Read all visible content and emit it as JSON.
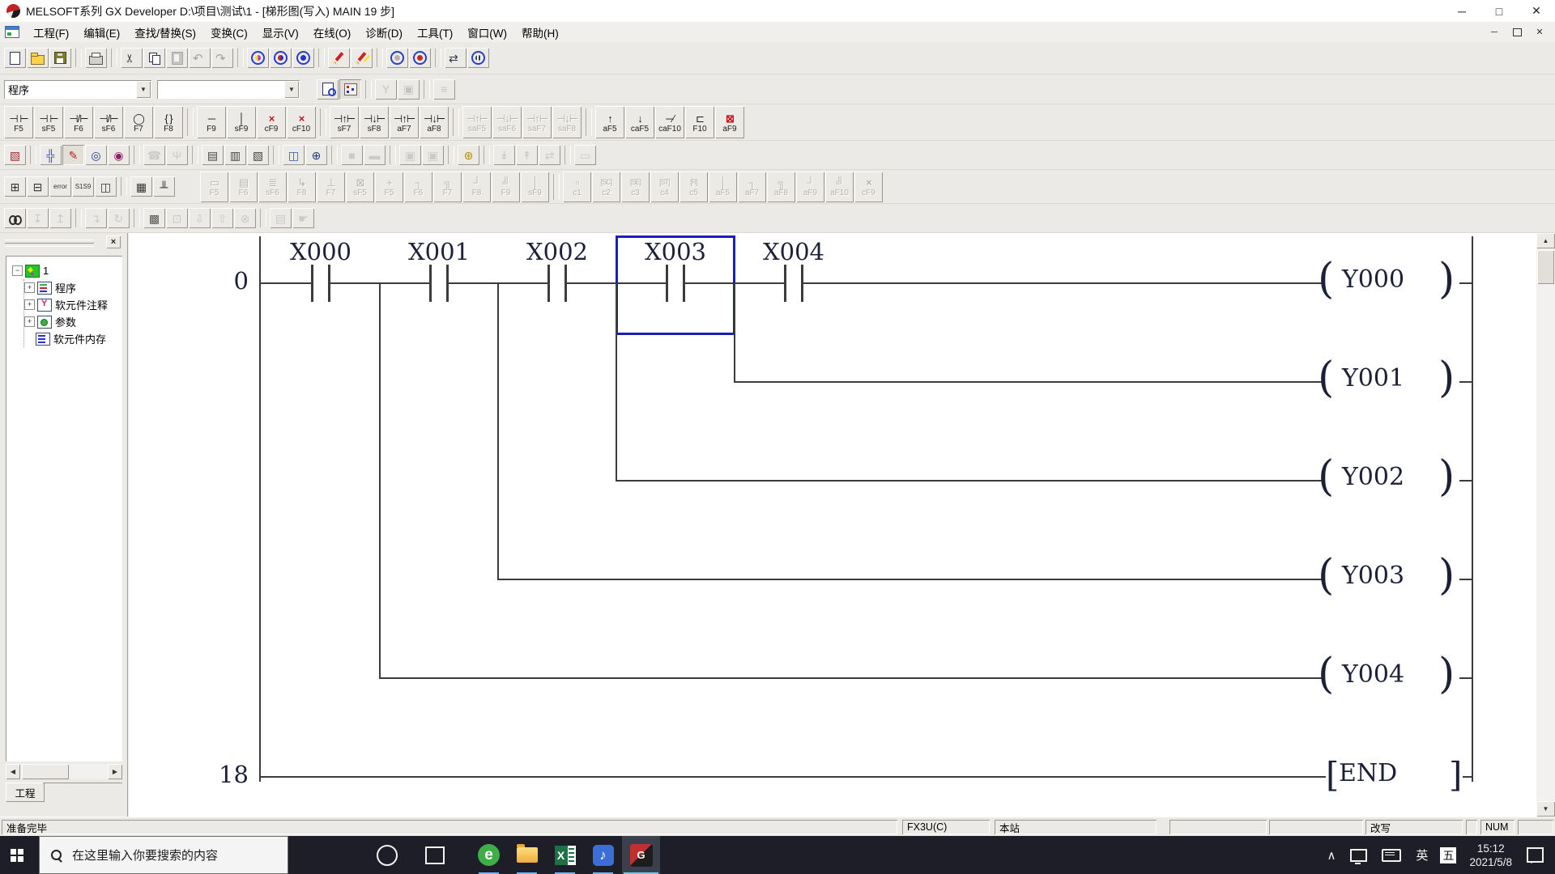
{
  "window": {
    "title": "MELSOFT系列 GX Developer D:\\项目\\测试\\1 - [梯形图(写入)    MAIN   19 步]",
    "controls": [
      {
        "name": "minimize-button",
        "glyph": "─"
      },
      {
        "name": "maximize-button",
        "glyph": "□"
      },
      {
        "name": "close-button",
        "glyph": "✕"
      }
    ],
    "mdi_controls": [
      {
        "name": "child-minimize-button",
        "glyph": "─"
      },
      {
        "name": "child-restore-button",
        "glyph": "❐"
      },
      {
        "name": "child-close-button",
        "glyph": "✕"
      }
    ]
  },
  "menu_bar": {
    "items": [
      "工程(F)",
      "编辑(E)",
      "查找/替换(S)",
      "变换(C)",
      "显示(V)",
      "在线(O)",
      "诊断(D)",
      "工具(T)",
      "窗口(W)",
      "帮助(H)"
    ]
  },
  "toolbars": {
    "rowA": [
      {
        "name": "new-project-button",
        "icon": "page"
      },
      {
        "name": "open-project-button",
        "icon": "folder"
      },
      {
        "name": "save-project-button",
        "icon": "floppy"
      },
      {
        "sep": true
      },
      {
        "name": "print-button",
        "icon": "printer"
      },
      {
        "sep": true
      },
      {
        "name": "cut-button",
        "icon": "scissors"
      },
      {
        "name": "copy-button",
        "icon": "copy"
      },
      {
        "name": "paste-button",
        "icon": "clipboard",
        "disabled": true
      },
      {
        "name": "undo-button",
        "icon": "undo",
        "disabled": true
      },
      {
        "name": "redo-button",
        "icon": "redo",
        "disabled": true
      },
      {
        "sep": true
      },
      {
        "name": "find-device-button",
        "icon": "ring-device"
      },
      {
        "name": "find-instruction-button",
        "icon": "ring-instruction"
      },
      {
        "name": "find-string-button",
        "icon": "ring-string"
      },
      {
        "sep": true
      },
      {
        "name": "ladder-write-button",
        "icon": "pencil"
      },
      {
        "name": "ladder-monitor-write-button",
        "icon": "pencil-star"
      },
      {
        "sep": true
      },
      {
        "name": "read-mode-button",
        "icon": "ring-read"
      },
      {
        "name": "write-mode-button",
        "icon": "ring-write"
      },
      {
        "sep": true
      },
      {
        "name": "transfer-setup-button",
        "icon": "transfer"
      },
      {
        "name": "monitor-mode-button",
        "icon": "ring-monitor"
      }
    ],
    "rowB": {
      "program_combo_value": "程序",
      "second_combo_value": "",
      "buttons": [
        {
          "name": "find-in-window-button",
          "icon": "page-find"
        },
        {
          "name": "project-tree-toggle-button",
          "icon": "tree",
          "pressed": true
        },
        {
          "sep": true
        },
        {
          "name": "parameter-edit-button",
          "glyph": "Y",
          "disabled": true
        },
        {
          "name": "screen-setting-button",
          "glyph": "▣",
          "disabled": true
        },
        {
          "sep": true
        },
        {
          "name": "program-list-button",
          "glyph": "≡",
          "disabled": true
        }
      ]
    },
    "rowC": [
      {
        "name": "open-contact-button",
        "sym": "⊣ ⊢",
        "label": "F5"
      },
      {
        "name": "open-branch-button",
        "sym": "⊣ ⊢",
        "label": "sF5"
      },
      {
        "name": "close-contact-button",
        "sym": "⊣/⊢",
        "label": "F6"
      },
      {
        "name": "close-branch-button",
        "sym": "⊣/⊢",
        "label": "sF6"
      },
      {
        "name": "coil-button",
        "sym": "◯",
        "label": "F7"
      },
      {
        "name": "application-instruction-button",
        "sym": "{ }",
        "label": "F8"
      },
      {
        "sep": true
      },
      {
        "name": "horizontal-line-button",
        "sym": "─",
        "label": "F9"
      },
      {
        "name": "vertical-line-button",
        "sym": "│",
        "label": "sF9"
      },
      {
        "name": "delete-horizontal-line-button",
        "sym": "×",
        "red": true,
        "label": "cF9"
      },
      {
        "name": "delete-vertical-line-button",
        "sym": "×",
        "red": true,
        "label": "cF10"
      },
      {
        "sep": true
      },
      {
        "name": "rising-pulse-button",
        "sym": "⊣↑⊢",
        "label": "sF7"
      },
      {
        "name": "falling-pulse-button",
        "sym": "⊣↓⊢",
        "label": "sF8"
      },
      {
        "name": "rising-pulse-branch-button",
        "sym": "⊣↑⊢",
        "label": "aF7"
      },
      {
        "name": "falling-pulse-branch-button",
        "sym": "⊣↓⊢",
        "label": "aF8"
      },
      {
        "sep": true
      },
      {
        "name": "rising-pulse-close-button",
        "sym": "⊣↑⊢",
        "label": "saF5",
        "disabled": true
      },
      {
        "name": "falling-pulse-close-button",
        "sym": "⊣↓⊢",
        "label": "saF6",
        "disabled": true
      },
      {
        "name": "rising-pulse-close-branch-button",
        "sym": "⊣↑⊢",
        "label": "saF7",
        "disabled": true
      },
      {
        "name": "falling-pulse-close-branch-button",
        "sym": "⊣↓⊢",
        "label": "saF8",
        "disabled": true
      },
      {
        "sep": true
      },
      {
        "name": "pulse-up-button",
        "sym": "↑",
        "label": "aF5"
      },
      {
        "name": "pulse-down-button",
        "sym": "↓",
        "label": "caF5"
      },
      {
        "name": "invert-operation-button",
        "sym": "─∕",
        "label": "caF10"
      },
      {
        "name": "horizontal-line-input-button",
        "sym": "⊏",
        "label": "F10"
      },
      {
        "name": "delete-line-button",
        "sym": "⊠",
        "red": true,
        "label": "aF9"
      }
    ],
    "rowD": [
      {
        "name": "ladder-logic-test-button",
        "icon": "▧",
        "color": "#a03030"
      },
      {
        "sep": true
      },
      {
        "name": "navigation-button",
        "icon": "╬",
        "color": "#3355bb"
      },
      {
        "name": "write-edit-button",
        "icon": "✎",
        "color": "#c02222",
        "pressed": true
      },
      {
        "name": "read-search-button",
        "icon": "◎",
        "color": "#223a88"
      },
      {
        "name": "write-search-button",
        "icon": "◉",
        "color": "#882266"
      },
      {
        "sep": true
      },
      {
        "name": "phone-line-button",
        "icon": "☎",
        "disabled": true
      },
      {
        "name": "wireless-button",
        "icon": "Ψ",
        "disabled": true
      },
      {
        "sep": true
      },
      {
        "name": "device-batch-button",
        "icon": "▤",
        "color": "#444444"
      },
      {
        "name": "device-ladder-button",
        "icon": "▥",
        "color": "#444444"
      },
      {
        "name": "device-test-button",
        "icon": "▧",
        "color": "#444444"
      },
      {
        "sep": true
      },
      {
        "name": "tile-windows-button",
        "icon": "◫",
        "color": "#3355bb"
      },
      {
        "name": "zoom-monitor-button",
        "icon": "⊕",
        "color": "#223a88"
      },
      {
        "sep": true
      },
      {
        "name": "dark-tool-a-button",
        "icon": "■",
        "disabled": true
      },
      {
        "name": "dark-tool-b-button",
        "icon": "▬",
        "disabled": true
      },
      {
        "sep": true
      },
      {
        "name": "window-jump-a-button",
        "icon": "▣",
        "disabled": true
      },
      {
        "name": "window-jump-b-button",
        "icon": "▣",
        "disabled": true
      },
      {
        "sep": true
      },
      {
        "name": "circuit-search-button",
        "icon": "⊛",
        "color": "#b08a00"
      },
      {
        "sep": true
      },
      {
        "name": "insert-rung-button",
        "icon": "↡",
        "disabled": true
      },
      {
        "name": "delete-rung-button",
        "icon": "↟",
        "disabled": true
      },
      {
        "name": "swap-rung-button",
        "icon": "⇄",
        "disabled": true
      },
      {
        "sep": true
      },
      {
        "name": "monitor-window-button",
        "icon": "▭",
        "disabled": true
      }
    ],
    "rowE_left": [
      {
        "name": "sfc-step-button",
        "icon": "⊞",
        "color": "#333333"
      },
      {
        "name": "sfc-block-button",
        "icon": "⊟",
        "color": "#333333"
      },
      {
        "name": "sfc-error-jump-button",
        "icon": "error",
        "small": true,
        "color": "#333333"
      },
      {
        "name": "sfc-sort-button",
        "icon": "S1S9",
        "small": true,
        "color": "#333333"
      },
      {
        "name": "sfc-split-button",
        "icon": "◫",
        "color": "#333333"
      },
      {
        "sep": true
      },
      {
        "name": "sfc-grid-button",
        "icon": "▦",
        "color": "#333333"
      },
      {
        "name": "sfc-branch-button",
        "icon": "╨",
        "color": "#333333"
      }
    ],
    "rowE_right": [
      {
        "name": "sfc-step-symbol-button",
        "sym": "▭",
        "label": "F5",
        "disabled": true
      },
      {
        "name": "sfc-transition-button",
        "sym": "▤",
        "label": "F6",
        "disabled": true
      },
      {
        "name": "sfc-selection-button",
        "sym": "≣",
        "label": "sF6",
        "disabled": true
      },
      {
        "name": "sfc-jump-button",
        "sym": "↳",
        "label": "F8",
        "disabled": true
      },
      {
        "name": "sfc-end-step-button",
        "sym": "⊥",
        "label": "F7",
        "disabled": true
      },
      {
        "name": "sfc-dummy-step-button",
        "sym": "⊠",
        "label": "sF5",
        "disabled": true
      },
      {
        "name": "sfc-vline-button",
        "sym": "+",
        "label": "F5",
        "disabled": true
      },
      {
        "name": "sfc-branch-a-button",
        "sym": "┐",
        "label": "F6",
        "disabled": true
      },
      {
        "name": "sfc-branch-b-button",
        "sym": "╗",
        "label": "F7",
        "disabled": true
      },
      {
        "name": "sfc-merge-a-button",
        "sym": "┘",
        "label": "F8",
        "disabled": true
      },
      {
        "name": "sfc-merge-b-button",
        "sym": "╝",
        "label": "F9",
        "disabled": true
      },
      {
        "name": "sfc-vline2-button",
        "sym": "│",
        "label": "sF9",
        "disabled": true
      },
      {
        "sep": true
      },
      {
        "name": "sfc-comment1-button",
        "sym": "▫",
        "label": "c1",
        "disabled": true
      },
      {
        "name": "sfc-sc-button",
        "sym": "[SC]",
        "small": true,
        "label": "c2",
        "disabled": true
      },
      {
        "name": "sfc-se-button",
        "sym": "[SE]",
        "small": true,
        "label": "c3",
        "disabled": true
      },
      {
        "name": "sfc-st-button",
        "sym": "[ST]",
        "small": true,
        "label": "c4",
        "disabled": true
      },
      {
        "name": "sfc-r-button",
        "sym": "[R]",
        "small": true,
        "label": "c5",
        "disabled": true
      },
      {
        "name": "sfc-line-a-button",
        "sym": "│",
        "label": "aF5",
        "disabled": true
      },
      {
        "name": "sfc-line-b-button",
        "sym": "┐",
        "label": "aF7",
        "disabled": true
      },
      {
        "name": "sfc-line-c-button",
        "sym": "╗",
        "label": "aF8",
        "disabled": true
      },
      {
        "name": "sfc-line-d-button",
        "sym": "┘",
        "label": "aF9",
        "disabled": true
      },
      {
        "name": "sfc-line-e-button",
        "sym": "╝",
        "label": "aF10",
        "disabled": true
      },
      {
        "name": "sfc-delete-button",
        "sym": "×",
        "red": true,
        "label": "cF9",
        "disabled": true
      }
    ],
    "rowF": [
      {
        "name": "find-button",
        "icon": "binoc"
      },
      {
        "name": "find-next-button",
        "icon": "↧",
        "disabled": true
      },
      {
        "name": "find-previous-button",
        "icon": "↥",
        "disabled": true
      },
      {
        "sep": true
      },
      {
        "name": "jump-button",
        "icon": "↴",
        "disabled": true
      },
      {
        "name": "repeat-find-button",
        "icon": "↻",
        "disabled": true
      },
      {
        "sep": true
      },
      {
        "name": "dark-grid-button",
        "icon": "▩",
        "color": "#555555"
      },
      {
        "name": "layers-button",
        "icon": "⊡",
        "disabled": true
      },
      {
        "name": "insert-line-button",
        "icon": "⇩",
        "disabled": true
      },
      {
        "name": "delete-line2-button",
        "icon": "⇧",
        "disabled": true
      },
      {
        "name": "remove-line-button",
        "icon": "⊗",
        "disabled": true
      },
      {
        "sep": true
      },
      {
        "name": "save-display-button",
        "icon": "▤",
        "disabled": true
      },
      {
        "name": "pan-hand-button",
        "icon": "☛",
        "disabled": true
      }
    ]
  },
  "project_tree": {
    "root_label": "1",
    "items": [
      {
        "label": "程序",
        "icon": "program",
        "expandable": true
      },
      {
        "label": "软元件注释",
        "icon": "comment",
        "expandable": true
      },
      {
        "label": "参数",
        "icon": "param",
        "expandable": true
      },
      {
        "label": "软元件内存",
        "icon": "memory",
        "expandable": false
      }
    ],
    "bottom_tab": "工程"
  },
  "ladder": {
    "contacts": [
      {
        "label": "X000"
      },
      {
        "label": "X001"
      },
      {
        "label": "X002"
      },
      {
        "label": "X003",
        "selected": true
      },
      {
        "label": "X004"
      }
    ],
    "rungs": [
      {
        "step": "0",
        "coil": "Y000"
      },
      {
        "coil": "Y001",
        "branch_after": 3
      },
      {
        "coil": "Y002",
        "branch_after": 2
      },
      {
        "coil": "Y003",
        "branch_after": 1
      },
      {
        "coil": "Y004",
        "branch_after": 0
      },
      {
        "step": "18",
        "instruction": "END"
      }
    ]
  },
  "status_bar": {
    "message": "准备完毕",
    "cpu_type": "FX3U(C)",
    "station": "本站",
    "edit_mode": "改写",
    "num_lock": "NUM"
  },
  "taskbar": {
    "search_placeholder": "在这里输入你要搜索的内容",
    "apps": [
      {
        "name": "taskbar-app-browser",
        "icon": "browser",
        "glyph": "e"
      },
      {
        "name": "taskbar-app-explorer",
        "icon": "folder",
        "glyph": ""
      },
      {
        "name": "taskbar-app-excel",
        "icon": "excel",
        "glyph": ""
      },
      {
        "name": "taskbar-app-music",
        "icon": "music",
        "glyph": "♪"
      },
      {
        "name": "taskbar-app-gx-developer",
        "icon": "gx",
        "glyph": "G",
        "active": true
      }
    ],
    "tray": {
      "language_primary": "英",
      "language_secondary": "五",
      "time": "15:12",
      "date": "2021/5/8"
    }
  }
}
